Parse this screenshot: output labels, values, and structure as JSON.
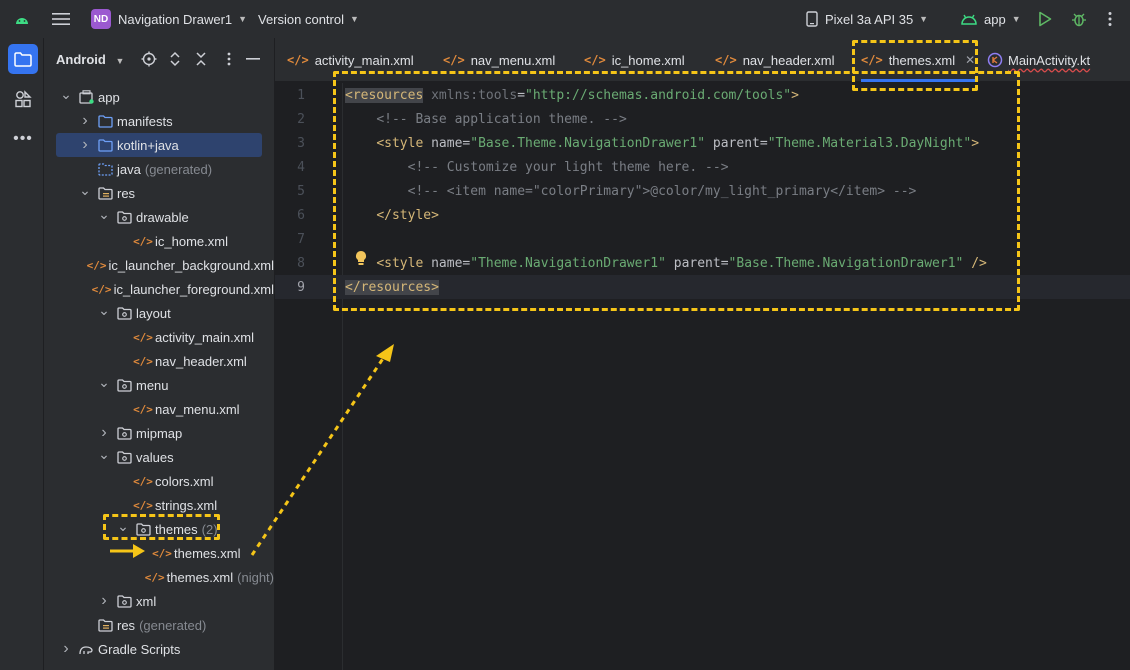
{
  "topbar": {
    "project_badge": "ND",
    "project_name": "Navigation Drawer1",
    "vcs_label": "Version control",
    "device_label": "Pixel 3a API 35",
    "run_config_label": "app"
  },
  "panel": {
    "title": "Android",
    "tree": [
      {
        "label": "app",
        "suffix": "",
        "depth": 0,
        "arrow": "down",
        "icon": "module-icon"
      },
      {
        "label": "manifests",
        "suffix": "",
        "depth": 1,
        "arrow": "right",
        "icon": "folder-icon"
      },
      {
        "label": "kotlin+java",
        "suffix": "",
        "depth": 1,
        "arrow": "right",
        "icon": "folder-icon"
      },
      {
        "label": "java",
        "suffix": "(generated)",
        "depth": 1,
        "arrow": "",
        "icon": "generated-folder-icon"
      },
      {
        "label": "res",
        "suffix": "",
        "depth": 1,
        "arrow": "down",
        "icon": "res-folder-icon"
      },
      {
        "label": "drawable",
        "suffix": "",
        "depth": 2,
        "arrow": "down",
        "icon": "package-folder-icon"
      },
      {
        "label": "ic_home.xml",
        "suffix": "",
        "depth": 3,
        "arrow": "",
        "icon": "xml-file-icon"
      },
      {
        "label": "ic_launcher_background.xml",
        "suffix": "",
        "depth": 3,
        "arrow": "",
        "icon": "xml-file-icon"
      },
      {
        "label": "ic_launcher_foreground.xml",
        "suffix": "",
        "depth": 3,
        "arrow": "",
        "icon": "xml-file-icon"
      },
      {
        "label": "layout",
        "suffix": "",
        "depth": 2,
        "arrow": "down",
        "icon": "package-folder-icon"
      },
      {
        "label": "activity_main.xml",
        "suffix": "",
        "depth": 3,
        "arrow": "",
        "icon": "xml-file-icon"
      },
      {
        "label": "nav_header.xml",
        "suffix": "",
        "depth": 3,
        "arrow": "",
        "icon": "xml-file-icon"
      },
      {
        "label": "menu",
        "suffix": "",
        "depth": 2,
        "arrow": "down",
        "icon": "package-folder-icon"
      },
      {
        "label": "nav_menu.xml",
        "suffix": "",
        "depth": 3,
        "arrow": "",
        "icon": "xml-file-icon"
      },
      {
        "label": "mipmap",
        "suffix": "",
        "depth": 2,
        "arrow": "right",
        "icon": "package-folder-icon"
      },
      {
        "label": "values",
        "suffix": "",
        "depth": 2,
        "arrow": "down",
        "icon": "package-folder-icon"
      },
      {
        "label": "colors.xml",
        "suffix": "",
        "depth": 3,
        "arrow": "",
        "icon": "xml-file-icon"
      },
      {
        "label": "strings.xml",
        "suffix": "",
        "depth": 3,
        "arrow": "",
        "icon": "xml-file-icon"
      },
      {
        "label": "themes",
        "suffix": "(2)",
        "depth": 3,
        "arrow": "down",
        "icon": "package-folder-icon"
      },
      {
        "label": "themes.xml",
        "suffix": "",
        "depth": 4,
        "arrow": "",
        "icon": "xml-file-icon"
      },
      {
        "label": "themes.xml",
        "suffix": "(night)",
        "depth": 4,
        "arrow": "",
        "icon": "xml-file-icon"
      },
      {
        "label": "xml",
        "suffix": "",
        "depth": 2,
        "arrow": "right",
        "icon": "package-folder-icon"
      },
      {
        "label": "res",
        "suffix": "(generated)",
        "depth": 1,
        "arrow": "",
        "icon": "res-folder-icon"
      },
      {
        "label": "Gradle Scripts",
        "suffix": "",
        "depth": 0,
        "arrow": "right",
        "icon": "gradle-icon"
      }
    ]
  },
  "tabs": [
    {
      "label": "activity_main.xml",
      "active": false,
      "icon": "xml-file-icon"
    },
    {
      "label": "nav_menu.xml",
      "active": false,
      "icon": "xml-file-icon"
    },
    {
      "label": "ic_home.xml",
      "active": false,
      "icon": "xml-file-icon"
    },
    {
      "label": "nav_header.xml",
      "active": false,
      "icon": "xml-file-icon"
    },
    {
      "label": "themes.xml",
      "active": true,
      "icon": "xml-file-icon"
    },
    {
      "label": "MainActivity.kt",
      "active": false,
      "icon": "kotlin-file-icon"
    }
  ],
  "editor": {
    "current_line": 9,
    "lines": [
      "<resources xmlns:tools=\"http://schemas.android.com/tools\">",
      "    <!-- Base application theme. -->",
      "    <style name=\"Base.Theme.NavigationDrawer1\" parent=\"Theme.Material3.DayNight\">",
      "        <!-- Customize your light theme here. -->",
      "        <!-- <item name=\"colorPrimary\">@color/my_light_primary</item> -->",
      "    </style>",
      "",
      "    <style name=\"Theme.NavigationDrawer1\" parent=\"Base.Theme.NavigationDrawer1\" />",
      "</resources>"
    ]
  },
  "colors": {
    "accent": "#3574f0",
    "annotation": "#f5c518",
    "xml_icon": "#e08a3c"
  }
}
